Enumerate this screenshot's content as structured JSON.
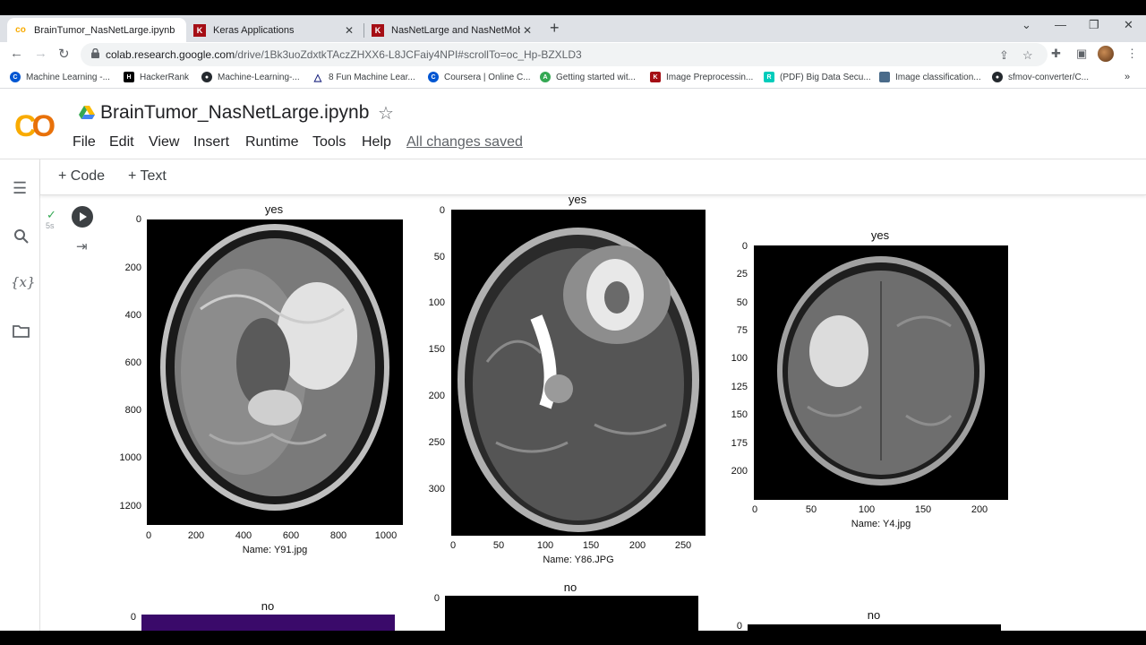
{
  "tabs": [
    {
      "title": "BrainTumor_NasNetLarge.ipynb",
      "icon": "colab-icon"
    },
    {
      "title": "Keras Applications",
      "icon": "keras-icon"
    },
    {
      "title": "NasNetLarge and NasNetMobile",
      "icon": "keras-icon"
    }
  ],
  "address": {
    "host": "colab.research.google.com",
    "path": "/drive/1Bk3uoZdxtkTAczZHXX6-L8JCFaiy4NPI#scrollTo=oc_Hp-BZXLD3"
  },
  "bookmarks": [
    {
      "label": "Machine Learning -...",
      "icon": "coursera-icon",
      "color": "#0056d2"
    },
    {
      "label": "HackerRank",
      "icon": "hackerrank-icon",
      "color": "#000000"
    },
    {
      "label": "Machine-Learning-...",
      "icon": "github-icon",
      "color": "#24292e"
    },
    {
      "label": "8 Fun Machine Lear...",
      "icon": "triangle-icon",
      "color": "#1a237e"
    },
    {
      "label": "Coursera | Online C...",
      "icon": "coursera-icon",
      "color": "#0056d2"
    },
    {
      "label": "Getting started wit...",
      "icon": "circle-a-icon",
      "color": "#34a853"
    },
    {
      "label": "Image Preprocessin...",
      "icon": "keras-icon",
      "color": "#a50e15"
    },
    {
      "label": "(PDF) Big Data Secu...",
      "icon": "researchgate-icon",
      "color": "#00ccbb"
    },
    {
      "label": "Image classification...",
      "icon": "page-icon",
      "color": "#4a6b8a"
    },
    {
      "label": "sfmov-converter/C...",
      "icon": "github-icon",
      "color": "#24292e"
    }
  ],
  "colab": {
    "logo": "CO",
    "title": "BrainTumor_NasNetLarge.ipynb",
    "menu": [
      "File",
      "Edit",
      "View",
      "Insert",
      "Runtime",
      "Tools",
      "Help"
    ],
    "saved": "All changes saved",
    "toolbar": {
      "code": "Code",
      "text": "Text"
    },
    "exec_time": "5s"
  },
  "plots": [
    {
      "title": "yes",
      "name": "Name: Y91.jpg",
      "yticks": [
        "0",
        "200",
        "400",
        "600",
        "800",
        "1000",
        "1200"
      ],
      "xticks": [
        "0",
        "200",
        "400",
        "600",
        "800",
        "1000"
      ]
    },
    {
      "title": "yes",
      "name": "Name: Y86.JPG",
      "yticks": [
        "0",
        "50",
        "100",
        "150",
        "200",
        "250",
        "300"
      ],
      "xticks": [
        "0",
        "50",
        "100",
        "150",
        "200",
        "250"
      ]
    },
    {
      "title": "yes",
      "name": "Name: Y4.jpg",
      "yticks": [
        "0",
        "25",
        "50",
        "75",
        "100",
        "125",
        "150",
        "175",
        "200"
      ],
      "xticks": [
        "0",
        "50",
        "100",
        "150",
        "200"
      ]
    },
    {
      "title": "no",
      "yticks": [
        "0"
      ]
    },
    {
      "title": "no",
      "yticks": [
        "0"
      ]
    },
    {
      "title": "no",
      "yticks": [
        "0"
      ]
    }
  ]
}
